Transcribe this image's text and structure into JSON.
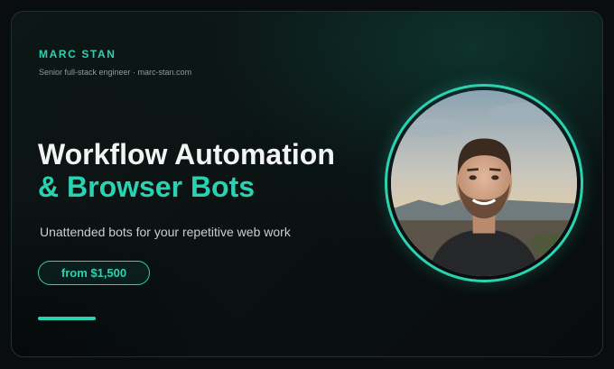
{
  "brand": {
    "name": "MARC STAN",
    "tagline": "Senior full-stack engineer · marc-stan.com"
  },
  "hero": {
    "title_line1": "Workflow Automation",
    "title_line2": "& Browser Bots",
    "subtitle": "Unattended bots for your repetitive web work",
    "price": "from $1,500"
  },
  "avatar": {
    "icon": "portrait-photo"
  },
  "colors": {
    "accent": "#2bd2b2",
    "background": "#0b1212",
    "text": "#f2f4f4"
  }
}
